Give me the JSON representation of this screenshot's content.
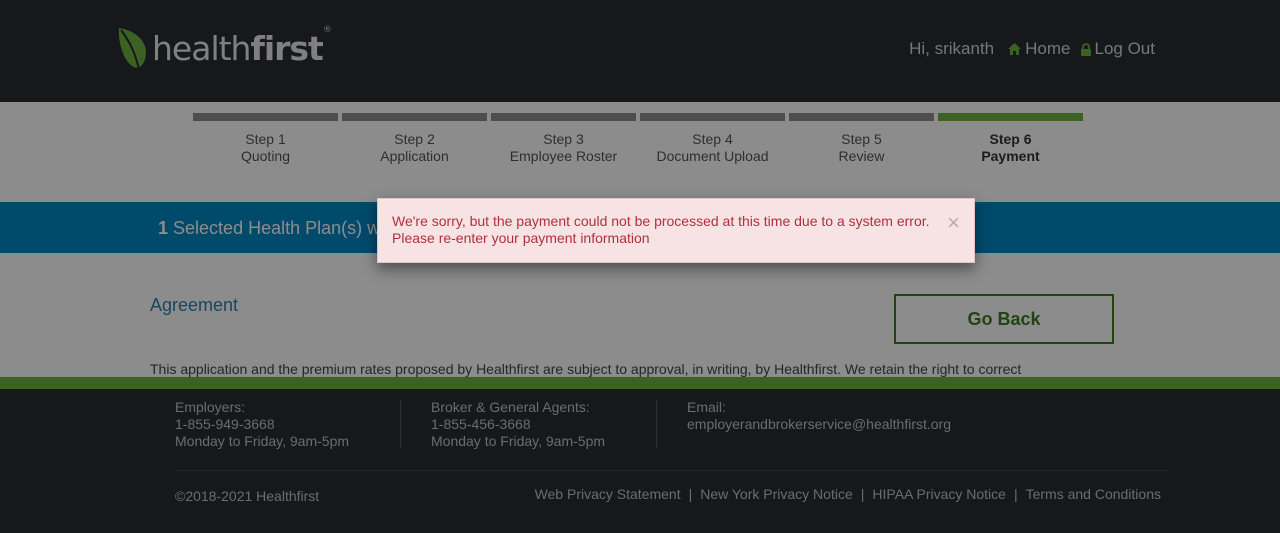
{
  "header": {
    "logo": {
      "text_light": "health",
      "text_bold": "first",
      "mark": "®"
    },
    "greeting": "Hi, srikanth",
    "home_label": "Home",
    "logout_label": "Log Out"
  },
  "steps": [
    {
      "number": "Step 1",
      "name": "Quoting"
    },
    {
      "number": "Step 2",
      "name": "Application"
    },
    {
      "number": "Step 3",
      "name": "Employee Roster"
    },
    {
      "number": "Step 4",
      "name": "Document Upload"
    },
    {
      "number": "Step 5",
      "name": "Review"
    },
    {
      "number": "Step 6",
      "name": "Payment"
    }
  ],
  "active_step": 6,
  "banner": {
    "count": "1",
    "text": "Selected Health Plan(s) w"
  },
  "agreement": {
    "title": "Agreement",
    "body": "This application and the premium rates proposed by Healthfirst are subject to approval, in writing, by Healthfirst. We retain the right to correct"
  },
  "go_back_label": "Go Back",
  "alert": {
    "message": "We're sorry, but the payment could not be processed at this time due to a system error. Please re-enter your payment information",
    "close": "×"
  },
  "footer": {
    "employers": {
      "label": "Employers:",
      "phone": "1-855-949-3668",
      "hours": "Monday to Friday, 9am-5pm"
    },
    "brokers": {
      "label": "Broker & General Agents:",
      "phone": "1-855-456-3668",
      "hours": "Monday to Friday, 9am-5pm"
    },
    "email": {
      "label": "Email:",
      "address": "employerandbrokerservice@healthfirst.org"
    },
    "copyright": "©2018-2021 Healthfirst",
    "links": [
      "Web Privacy Statement",
      "New York Privacy Notice",
      "HIPAA Privacy Notice",
      "Terms and Conditions"
    ],
    "separator": "|"
  },
  "colors": {
    "header_bg": "#2b2d33",
    "accent_green": "#6cb33f",
    "banner_blue": "#0088c5",
    "alert_bg": "#f8e3e4",
    "alert_text": "#b0303f"
  },
  "icons": {
    "home": "home-icon",
    "logout": "lock-icon",
    "logo": "leaf-icon",
    "close": "close-icon"
  }
}
